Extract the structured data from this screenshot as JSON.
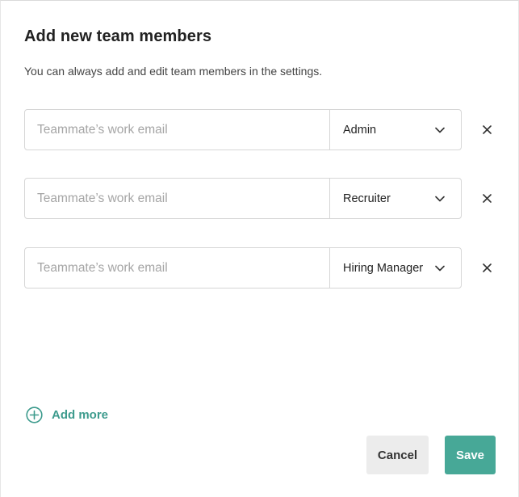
{
  "dialog": {
    "title": "Add new team members",
    "subtitle": "You can always add and edit team members in the settings."
  },
  "members": [
    {
      "email_value": "",
      "email_placeholder": "Teammate’s work email",
      "role": "Admin"
    },
    {
      "email_value": "",
      "email_placeholder": "Teammate’s work email",
      "role": "Recruiter"
    },
    {
      "email_value": "",
      "email_placeholder": "Teammate’s work email",
      "role": "Hiring Manager"
    }
  ],
  "icons": {
    "role_dropdown": "chevron-down-icon",
    "remove_row": "close-icon",
    "add_more": "plus-circle-icon"
  },
  "add_more_label": "Add more",
  "actions": {
    "cancel_label": "Cancel",
    "save_label": "Save"
  },
  "colors": {
    "accent": "#47a897",
    "accent_text": "#3d9b8d",
    "cancel_bg": "#ececec",
    "border": "#d6d6d6",
    "placeholder": "#a5a5a5"
  }
}
